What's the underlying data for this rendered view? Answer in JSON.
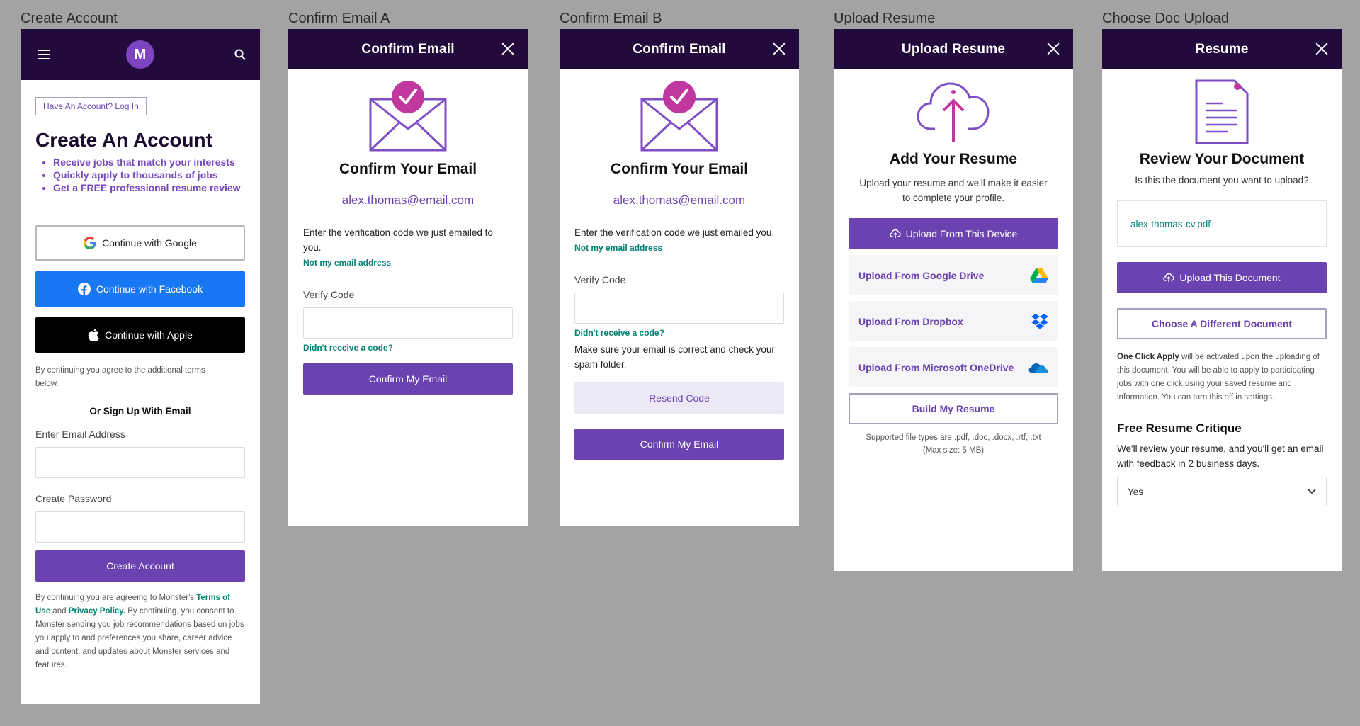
{
  "artboards": {
    "create": "Create Account",
    "confirm_a": "Confirm Email A",
    "confirm_b": "Confirm Email B",
    "upload": "Upload Resume",
    "choose": "Choose Doc Upload"
  },
  "create_account": {
    "logo_letter": "M",
    "login_link": "Have An Account? Log In",
    "title": "Create An Account",
    "benefits": [
      "Receive jobs that match your interests",
      "Quickly apply to thousands of jobs",
      "Get a FREE professional resume review"
    ],
    "google_label": "Continue with Google",
    "facebook_label": "Continue with Facebook",
    "apple_label": "Continue with Apple",
    "terms_note": "By continuing you agree to the additional terms below.",
    "or_email": "Or Sign Up With Email",
    "email_label": "Enter Email Address",
    "password_label": "Create Password",
    "create_button": "Create Account",
    "legal_1": "By continuing you are agreeing to Monster's ",
    "legal_terms": "Terms of Use",
    "legal_and": " and ",
    "legal_privacy": "Privacy Policy.",
    "legal_2": " By continuing, you consent to Monster sending you job recommendations based on jobs you apply to and preferences you share, career advice and content, and updates about Monster services and features.",
    "colors": {
      "header_bg": "#230a3c",
      "accent": "#6b43b0",
      "facebook": "#1877f2",
      "apple": "#000000",
      "link": "#008272"
    }
  },
  "confirm_a": {
    "header": "Confirm Email",
    "title": "Confirm Your Email",
    "email": "alex.thomas@email.com",
    "instructions": "Enter the verification code we just emailed to you.",
    "not_my_email": "Not my email address",
    "verify_label": "Verify Code",
    "didnt_receive": "Didn't receive a code?",
    "confirm_button": "Confirm My Email"
  },
  "confirm_b": {
    "header": "Confirm Email",
    "title": "Confirm Your Email",
    "email": "alex.thomas@email.com",
    "instructions": "Enter the verification code we just emailed you.",
    "not_my_email": "Not my email address",
    "verify_label": "Verify Code",
    "didnt_receive": "Didn't receive a code?",
    "help_text": "Make sure your email is correct and check your spam folder.",
    "resend_button": "Resend Code",
    "confirm_button": "Confirm My Email"
  },
  "upload_resume": {
    "header": "Upload Resume",
    "title": "Add Your Resume",
    "subtitle": "Upload your resume and we'll make it easier to complete your profile.",
    "device_button": "Upload From This Device",
    "options": [
      {
        "label": "Upload From Google Drive",
        "icon": "google-drive-icon"
      },
      {
        "label": "Upload From Dropbox",
        "icon": "dropbox-icon"
      },
      {
        "label": "Upload From Microsoft OneDrive",
        "icon": "onedrive-icon"
      }
    ],
    "build_button": "Build My Resume",
    "supported_types": "Supported file types are .pdf, .doc, .docx, .rtf, .txt",
    "max_size": "(Max size: 5 MB)"
  },
  "choose_doc": {
    "header": "Resume",
    "title": "Review Your Document",
    "question": "Is this the document you want to upload?",
    "filename": "alex-thomas-cv.pdf",
    "upload_button": "Upload This Document",
    "choose_button": "Choose A Different Document",
    "one_click_bold": "One Click Apply",
    "one_click_rest": " will be activated upon the uploading of this document. You will be able to apply to participating jobs with one click using your saved resume and information. You can turn this off in settings.",
    "critique_title": "Free Resume Critique",
    "critique_text": "We'll review your resume, and you'll get an email with feedback in 2 business days.",
    "select_value": "Yes"
  }
}
